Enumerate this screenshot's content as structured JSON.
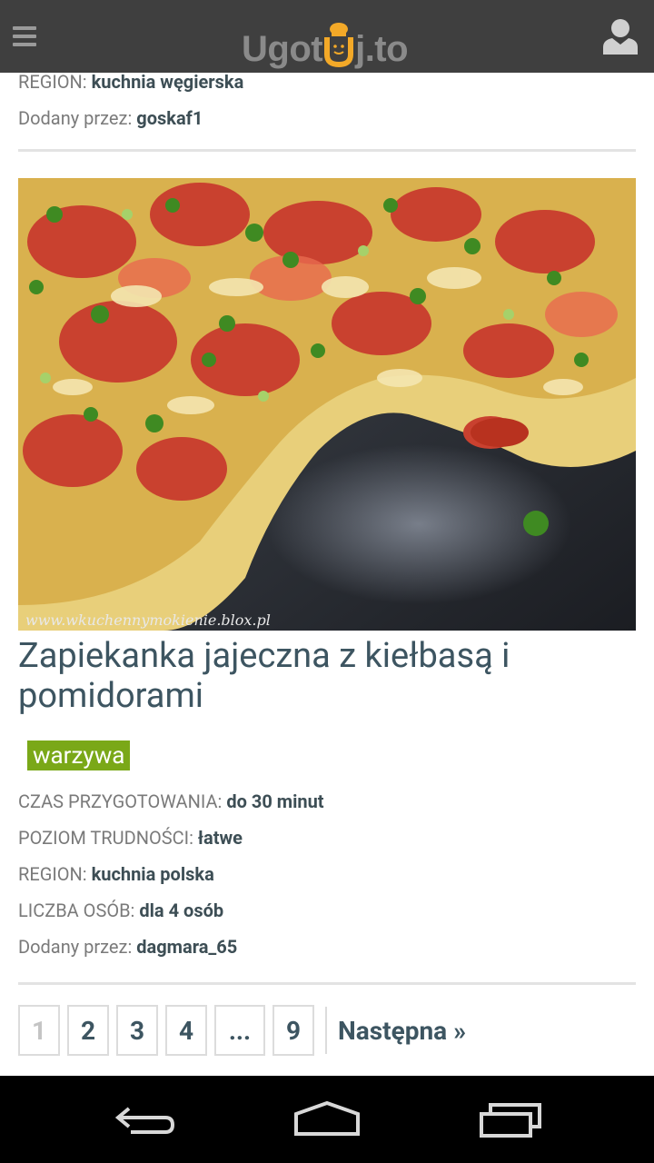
{
  "app": {
    "logo_left": "Ugot",
    "logo_right": "j.to"
  },
  "prev_recipe": {
    "region_label": "REGION:",
    "region_value": "kuchnia węgierska",
    "added_by_label": "Dodany przez:",
    "added_by_value": "goskaf1"
  },
  "recipe": {
    "image_watermark": "www.wkuchennymokienie.blox.pl",
    "title": "Zapiekanka jajeczna z kiełbasą i pomidorami",
    "tag": "warzywa",
    "meta": [
      {
        "label": "CZAS PRZYGOTOWANIA:",
        "value": "do 30 minut"
      },
      {
        "label": "POZIOM TRUDNOŚCI:",
        "value": "łatwe"
      },
      {
        "label": "REGION:",
        "value": "kuchnia polska"
      },
      {
        "label": "LICZBA OSÓB:",
        "value": "dla 4 osób"
      },
      {
        "label": "Dodany przez:",
        "value": "dagmara_65"
      }
    ]
  },
  "pagination": {
    "pages": [
      "1",
      "2",
      "3",
      "4",
      "...",
      "9"
    ],
    "current": "1",
    "next_label": "Następna »"
  },
  "colors": {
    "topbar": "#3f3f3f",
    "accent_green": "#7aa818",
    "title_blue": "#3d5561"
  }
}
